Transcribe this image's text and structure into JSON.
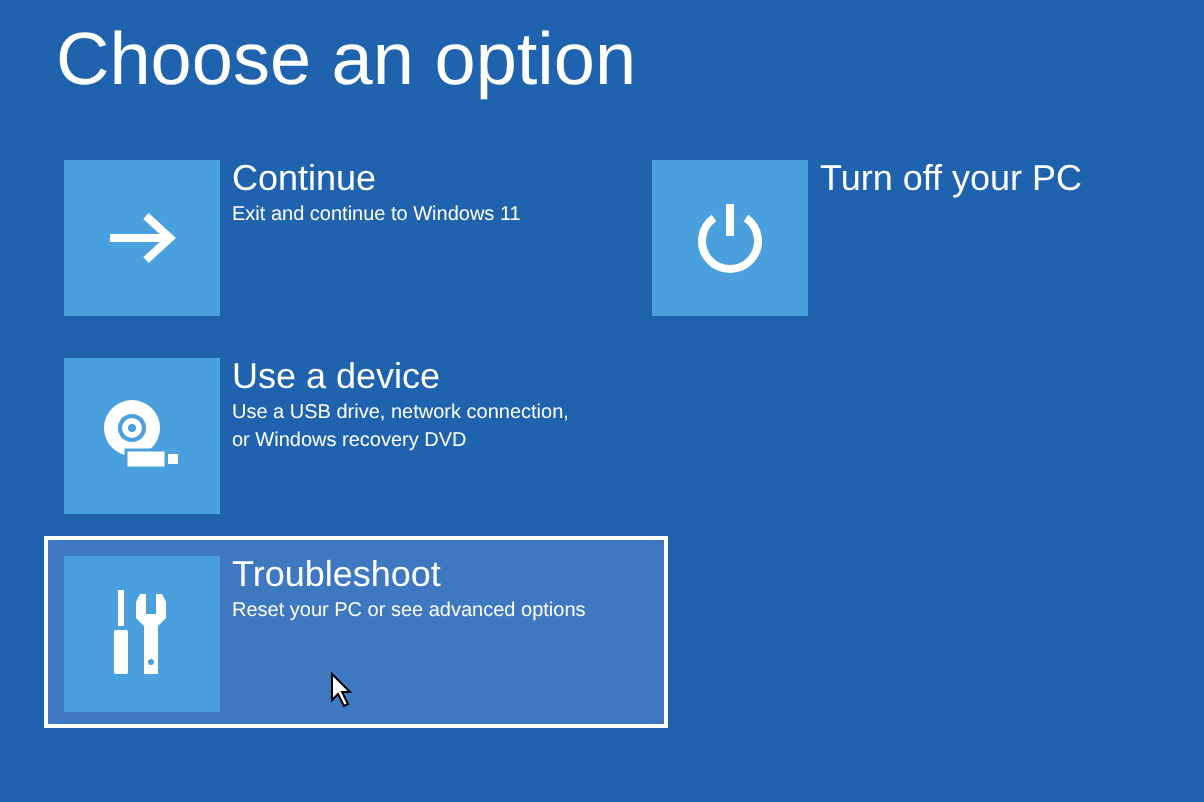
{
  "title": "Choose an option",
  "columns": [
    [
      {
        "kind": "continue",
        "label": "Continue",
        "description": "Exit and continue to Windows 11",
        "selected": false
      },
      {
        "kind": "device",
        "label": "Use a device",
        "description": "Use a USB drive, network connection,\nor Windows recovery DVD",
        "selected": false
      },
      {
        "kind": "troubleshoot",
        "label": "Troubleshoot",
        "description": "Reset your PC or see advanced options",
        "selected": true
      }
    ],
    [
      {
        "kind": "power",
        "label": "Turn off your PC",
        "selected": false
      }
    ]
  ]
}
